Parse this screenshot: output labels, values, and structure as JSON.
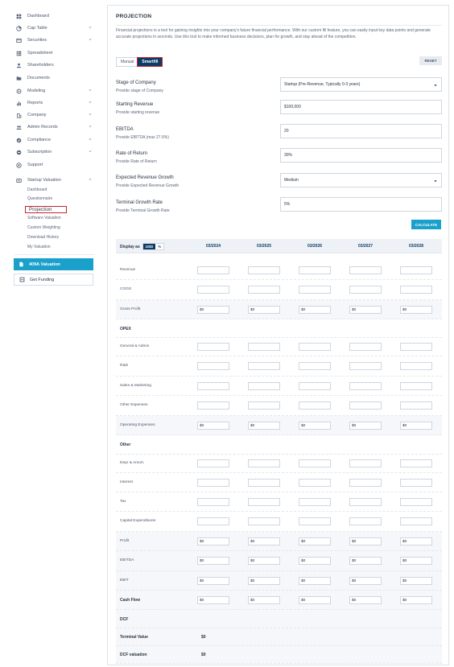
{
  "sidebar": {
    "items": [
      {
        "label": "Dashboard",
        "icon": "dashboard-icon",
        "chevron": false
      },
      {
        "label": "Cap Table",
        "icon": "cap-table-icon",
        "chevron": true
      },
      {
        "label": "Securities",
        "icon": "securities-icon",
        "chevron": true
      },
      {
        "label": "Spreadsheet",
        "icon": "spreadsheet-icon",
        "chevron": false
      },
      {
        "label": "Shareholders",
        "icon": "shareholders-icon",
        "chevron": false
      },
      {
        "label": "Documents",
        "icon": "documents-icon",
        "chevron": false
      },
      {
        "label": "Modeling",
        "icon": "modeling-icon",
        "chevron": true
      },
      {
        "label": "Reports",
        "icon": "reports-icon",
        "chevron": true
      },
      {
        "label": "Company",
        "icon": "company-icon",
        "chevron": true
      },
      {
        "label": "Admin Records",
        "icon": "admin-records-icon",
        "chevron": true
      },
      {
        "label": "Compliance",
        "icon": "compliance-icon",
        "chevron": true
      },
      {
        "label": "Subscription",
        "icon": "subscription-icon",
        "chevron": true
      },
      {
        "label": "Support",
        "icon": "support-icon",
        "chevron": false
      }
    ],
    "valuation": {
      "label": "Startup Valuation",
      "icon": "startup-valuation-icon"
    },
    "sub_items": [
      "Dashboard",
      "Questionnaire",
      "Projection",
      "Software Valuation",
      "Custom Weighting",
      "Download History",
      "My Valuation"
    ],
    "active_sub": "Projection",
    "btn_409a": "409A Valuation",
    "btn_funding": "Get Funding"
  },
  "page": {
    "title": "PROJECTION",
    "description": "Financial projections is a tool for gaining insights into your company's future financial performance. With our custom fill feature, you can easily input key data points and generate accurate projections in seconds. Use this tool to make informed business decisions, plan for growth, and stay ahead of the competition.",
    "mode_manual": "Manual",
    "mode_smartfill": "Smartfill",
    "active_mode": "Smartfill",
    "reset": "RESET",
    "calculate": "CALCULATE"
  },
  "fields": [
    {
      "label": "Stage of Company",
      "hint": "Provide stage of Company",
      "value": "Startup (Pre-Revenue, Typically 0-3 years)",
      "select": true
    },
    {
      "label": "Starting Revenue",
      "hint": "Provide starting revenue",
      "value": "$100,000",
      "select": false
    },
    {
      "label": "EBITDA",
      "hint": "Provide EBITDA (max 27.6%)",
      "value": "20",
      "select": false
    },
    {
      "label": "Rate of Return",
      "hint": "Provide Rate of Return",
      "value": "30%",
      "select": false
    },
    {
      "label": "Expected Revenue Growth",
      "hint": "Provide Expected Revenue Growth",
      "value": "Medium",
      "select": true
    },
    {
      "label": "Terminal Growth Rate",
      "hint": "Provide Terminal Growth Rate",
      "value": "5%",
      "select": false
    }
  ],
  "table": {
    "display_as": "Display as",
    "units": [
      "USD",
      "%"
    ],
    "active_unit": "USD",
    "columns": [
      "03/2024",
      "03/2025",
      "03/2026",
      "03/2027",
      "03/2028"
    ],
    "rows": [
      {
        "label": "Revenue",
        "kind": "input",
        "value": ""
      },
      {
        "label": "COGS",
        "kind": "input",
        "value": ""
      },
      {
        "label": "Gross Profit",
        "kind": "calc",
        "value": "$0"
      },
      {
        "label": "OPEX",
        "kind": "section",
        "value": ""
      },
      {
        "label": "General & Admin",
        "kind": "input",
        "value": ""
      },
      {
        "label": "R&D",
        "kind": "input",
        "value": ""
      },
      {
        "label": "Sales & Marketing",
        "kind": "input",
        "value": ""
      },
      {
        "label": "Other Expenses",
        "kind": "input",
        "value": ""
      },
      {
        "label": "Operating Expenses",
        "kind": "calc",
        "value": "$0"
      },
      {
        "label": "Other",
        "kind": "section",
        "value": ""
      },
      {
        "label": "Depr & Amort.",
        "kind": "input",
        "value": ""
      },
      {
        "label": "Interest",
        "kind": "input",
        "value": ""
      },
      {
        "label": "Tax",
        "kind": "input",
        "value": ""
      },
      {
        "label": "Capital Expenditures",
        "kind": "input",
        "value": ""
      },
      {
        "label": "Profit",
        "kind": "calc",
        "value": "$0"
      },
      {
        "label": "EBITDA",
        "kind": "calc",
        "value": "$0"
      },
      {
        "label": "EBIT",
        "kind": "calc",
        "value": "$0"
      },
      {
        "label": "Cash Flow",
        "kind": "calc-bold",
        "value": "$0"
      },
      {
        "label": "DCF",
        "kind": "section",
        "value": ""
      },
      {
        "label": "Terminal Value",
        "kind": "dcf",
        "value": "$0"
      },
      {
        "label": "DCF valuation",
        "kind": "dcf",
        "value": "$0"
      }
    ]
  }
}
